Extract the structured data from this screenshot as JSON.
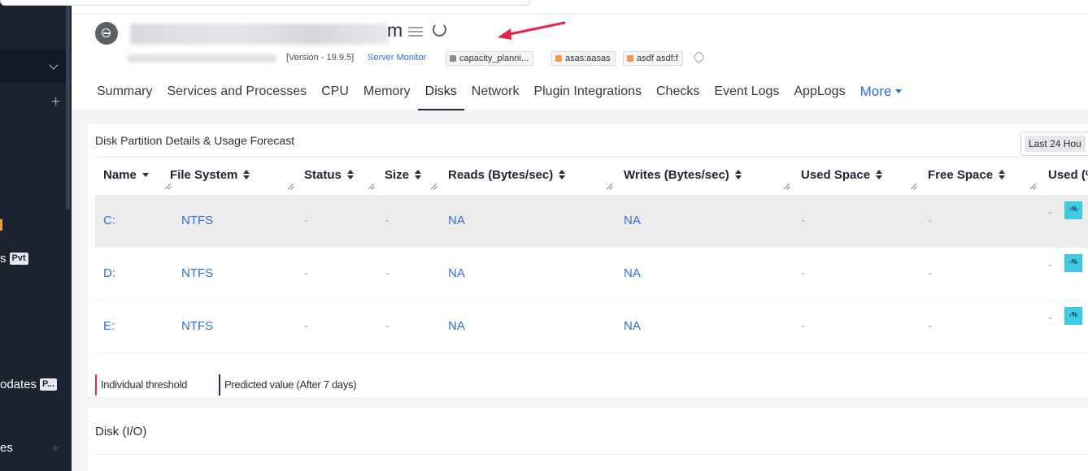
{
  "sidebar": {
    "fragments": [
      "s",
      "odates",
      "es"
    ],
    "badges": [
      "Pvt",
      "P..."
    ]
  },
  "header": {
    "title_visible_end": "m",
    "version": "[Version - 19.9.5]",
    "monitor_type": "Server Monitor",
    "tags": [
      {
        "label": "capacity_planni...",
        "color": "#8d8f93"
      },
      {
        "label": "asas:aasas",
        "color": "#f2994a"
      },
      {
        "label": "asdf asdf:f",
        "color": "#f2994a"
      }
    ]
  },
  "tabs": [
    {
      "label": "Summary"
    },
    {
      "label": "Services and Processes"
    },
    {
      "label": "CPU"
    },
    {
      "label": "Memory"
    },
    {
      "label": "Disks",
      "active": true
    },
    {
      "label": "Network"
    },
    {
      "label": "Plugin Integrations"
    },
    {
      "label": "Checks"
    },
    {
      "label": "Event Logs"
    },
    {
      "label": "AppLogs"
    },
    {
      "label": "More"
    }
  ],
  "disk_panel": {
    "title": "Disk Partition Details & Usage Forecast",
    "range": "Last 24 Hou",
    "columns": [
      "Name",
      "File System",
      "Status",
      "Size",
      "Reads (Bytes/sec)",
      "Writes (Bytes/sec)",
      "Used Space",
      "Free Space",
      "Used (%"
    ],
    "rows": [
      {
        "name": "C:",
        "fs": "NTFS",
        "status": "-",
        "size": "-",
        "reads": "NA",
        "writes": "NA",
        "used_space": "-",
        "free_space": "-",
        "used_pct": "-",
        "pct_badge": "-%"
      },
      {
        "name": "D:",
        "fs": "NTFS",
        "status": "-",
        "size": "-",
        "reads": "NA",
        "writes": "NA",
        "used_space": "-",
        "free_space": "-",
        "used_pct": "-",
        "pct_badge": "-%"
      },
      {
        "name": "E:",
        "fs": "NTFS",
        "status": "-",
        "size": "-",
        "reads": "NA",
        "writes": "NA",
        "used_space": "-",
        "free_space": "-",
        "used_pct": "-",
        "pct_badge": "-%"
      }
    ],
    "legend": [
      {
        "label": "Individual threshold",
        "color": "#e0334a"
      },
      {
        "label": "Predicted value (After 7 days)",
        "color": "#1b2a6b"
      }
    ]
  },
  "io_panel": {
    "title": "Disk (I/O)"
  },
  "colors": {
    "sidebar_bg": "#1b2230",
    "link": "#2f6fd3",
    "badge_cyan": "#3ccbe2",
    "arrow": "#e8234a"
  }
}
